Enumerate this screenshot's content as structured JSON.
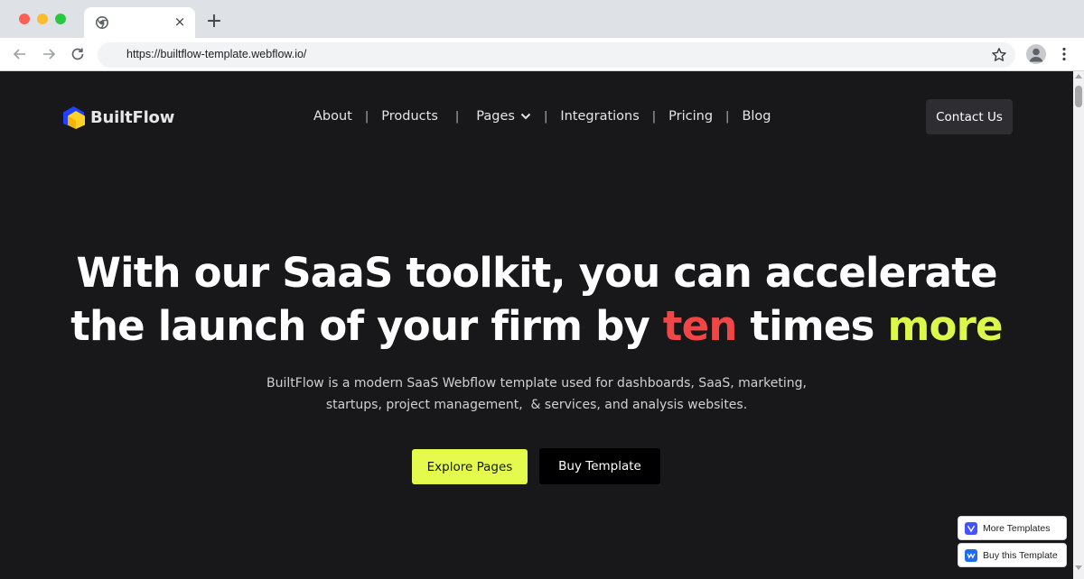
{
  "browser": {
    "url": "https://builtflow-template.webflow.io/",
    "tab_close": "×",
    "new_tab": "+"
  },
  "site": {
    "logo_text": "BuiltFlow",
    "nav": [
      {
        "label": "About"
      },
      {
        "label": "Products"
      },
      {
        "label": "Pages"
      },
      {
        "label": "Integrations"
      },
      {
        "label": "Pricing"
      },
      {
        "label": "Blog"
      }
    ],
    "nav_separator": "|",
    "contact_label": "Contact Us"
  },
  "hero": {
    "headline_part1": "With our SaaS toolkit, you can accelerate",
    "headline_part2": "the launch of your firm by ",
    "headline_red": "ten",
    "headline_part3": " times ",
    "headline_lime": "more",
    "subtitle_line1": "BuiltFlow is a modern SaaS Webflow template used for dashboards, SaaS, marketing,",
    "subtitle_line2": "startups, project management,  & services, and analysis websites.",
    "explore_label": "Explore Pages",
    "buy_label": "Buy Template"
  },
  "webflow_badges": {
    "more_templates": "More Templates",
    "buy_template": "Buy this Template"
  },
  "colors": {
    "background": "#18181b",
    "accent_lime": "#e4fb4e",
    "accent_red": "#f04646"
  }
}
